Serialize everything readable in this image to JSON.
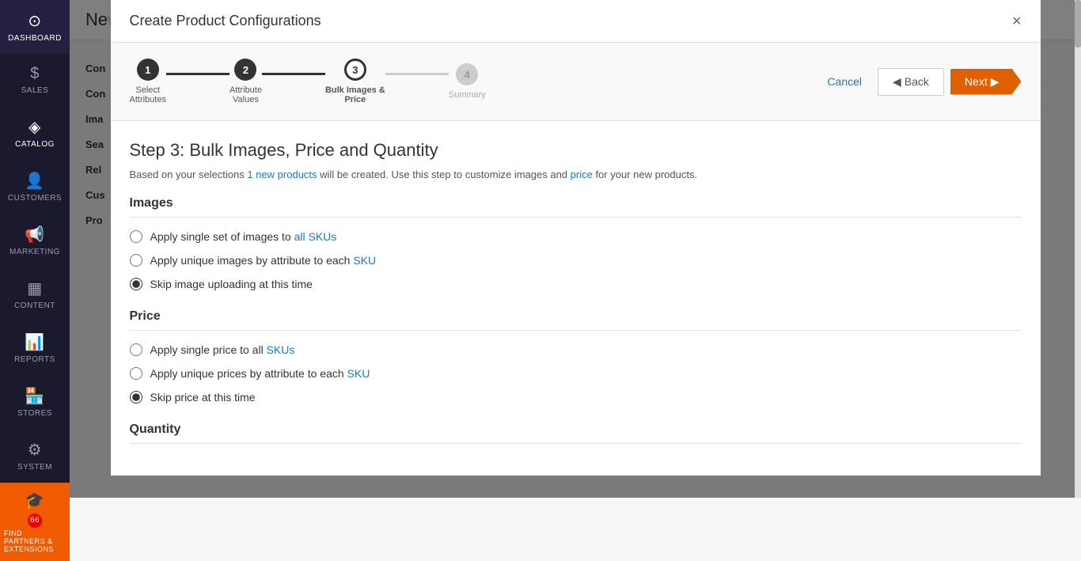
{
  "sidebar": {
    "items": [
      {
        "id": "dashboard",
        "label": "DASHBOARD",
        "icon": "⊙"
      },
      {
        "id": "sales",
        "label": "SALES",
        "icon": "$"
      },
      {
        "id": "catalog",
        "label": "CATALOG",
        "icon": "◈",
        "active": true
      },
      {
        "id": "customers",
        "label": "CUSTOMERS",
        "icon": "👤"
      },
      {
        "id": "marketing",
        "label": "MARKETING",
        "icon": "📢"
      },
      {
        "id": "content",
        "label": "CONTENT",
        "icon": "▦"
      },
      {
        "id": "reports",
        "label": "REPORTS",
        "icon": "▦"
      },
      {
        "id": "stores",
        "label": "STORES",
        "icon": "🏪"
      },
      {
        "id": "system",
        "label": "SYSTEM",
        "icon": "⚙"
      },
      {
        "id": "extensions",
        "label": "FIND PARTNERS & EXTENSIONS",
        "icon": "🎓",
        "badge": "66"
      }
    ]
  },
  "modal": {
    "title": "Create Product Configurations",
    "close_label": "×",
    "stepper": {
      "steps": [
        {
          "id": "step1",
          "number": "1",
          "label": "Select\nAttributes",
          "state": "completed"
        },
        {
          "id": "step2",
          "number": "2",
          "label": "Attribute\nValues",
          "state": "completed"
        },
        {
          "id": "step3",
          "number": "3",
          "label": "Bulk Images &\nPrice",
          "state": "active"
        },
        {
          "id": "step4",
          "number": "4",
          "label": "Summary",
          "state": "inactive"
        }
      ]
    },
    "buttons": {
      "cancel": "Cancel",
      "back": "Back",
      "next": "Next"
    },
    "body": {
      "step_title": "Step 3: Bulk Images, Price and Quantity",
      "step_desc_prefix": "Based on your selections ",
      "step_desc_count": "1 new products",
      "step_desc_middle": " will be created. Use this step to customize images and ",
      "step_desc_price": "price",
      "step_desc_suffix": " for your new products.",
      "images_section": {
        "title": "Images",
        "options": [
          {
            "id": "img1",
            "label_prefix": "Apply single set of images to ",
            "label_link": "all SKUs",
            "checked": false
          },
          {
            "id": "img2",
            "label_prefix": "Apply unique images by attribute to each ",
            "label_link": "SKU",
            "checked": false
          },
          {
            "id": "img3",
            "label_prefix": "Skip image uploading at this time",
            "label_link": "",
            "checked": true
          }
        ]
      },
      "price_section": {
        "title": "Price",
        "options": [
          {
            "id": "pr1",
            "label_prefix": "Apply single price to all ",
            "label_link": "SKUs",
            "checked": false
          },
          {
            "id": "pr2",
            "label_prefix": "Apply unique prices by attribute to each ",
            "label_link": "SKU",
            "checked": false
          },
          {
            "id": "pr3",
            "label_prefix": "Skip price at this time",
            "label_link": "",
            "checked": true
          }
        ]
      },
      "quantity_section": {
        "title": "Quantity"
      }
    }
  }
}
